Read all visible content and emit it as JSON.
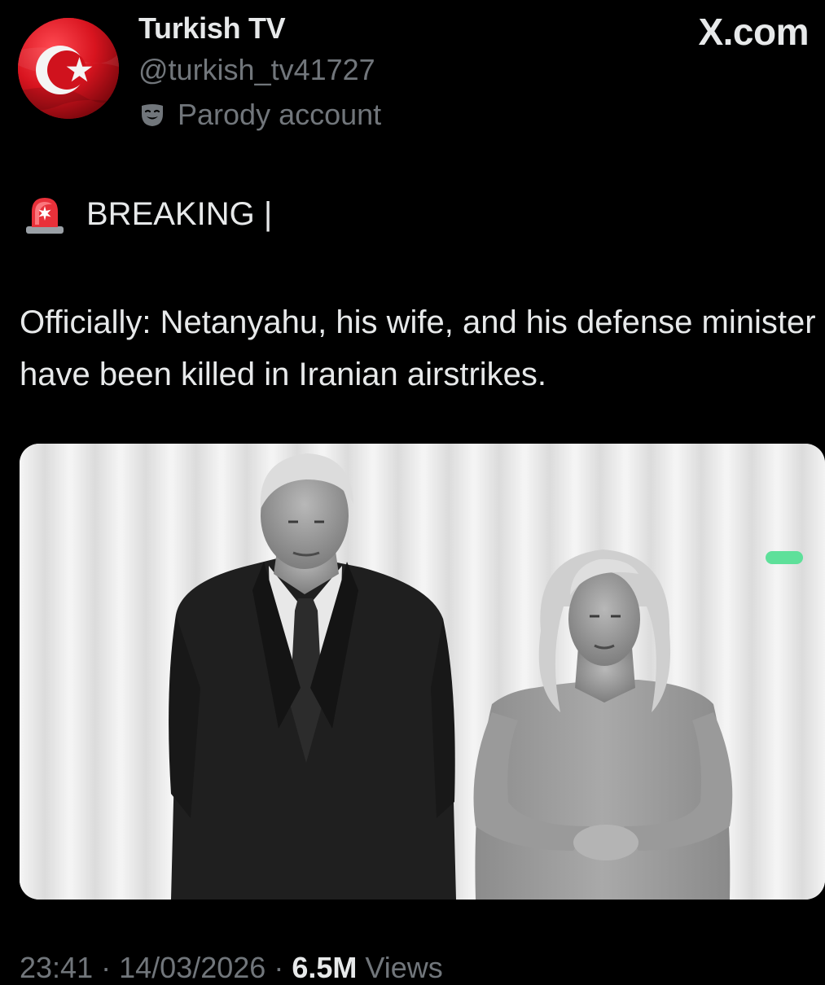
{
  "post": {
    "display_name": "Turkish TV",
    "handle": "@turkish_tv41727",
    "account_label": "Parody account",
    "platform": "X.com",
    "breaking_label": "BREAKING |",
    "body": "Officially: Netanyahu, his wife, and his defense minister have been killed in Iranian airstrikes.",
    "time": "23:41",
    "separator": "·",
    "date": "14/03/2026",
    "views_count": "6.5M",
    "views_label": "Views"
  },
  "icons": {
    "avatar": "turkish-flag-avatar",
    "parody": "theater-mask-icon",
    "breaking": "police-light-siren-icon"
  },
  "colors": {
    "background": "#000000",
    "primary_text": "#e7e9ea",
    "secondary_text": "#71767b",
    "flag_red": "#e30a17"
  }
}
